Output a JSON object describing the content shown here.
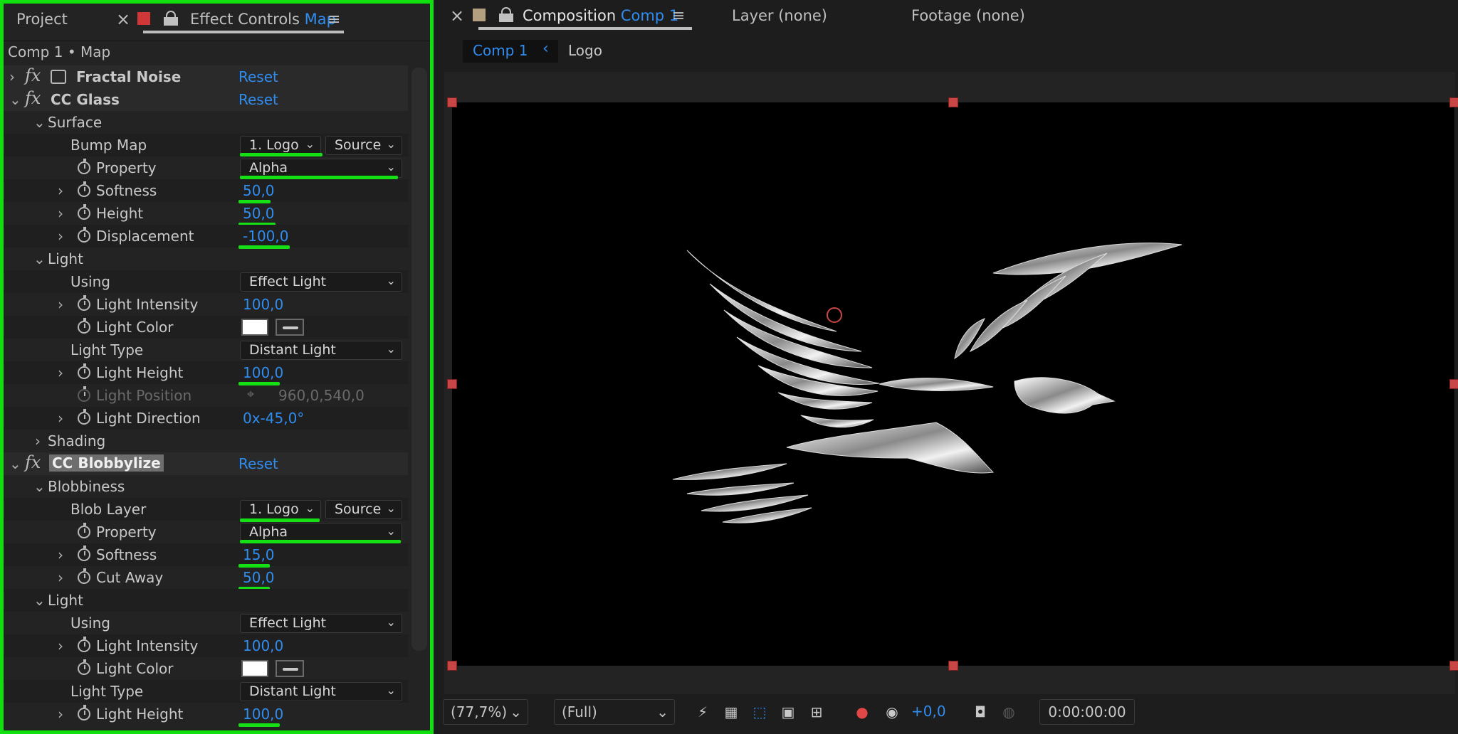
{
  "left_panel": {
    "tabs": {
      "project": "Project",
      "close": "×",
      "effect_controls": "Effect Controls",
      "effect_controls_target": "Map",
      "menu": "≡"
    },
    "breadcrumb": "Comp 1 • Map",
    "effects": [
      {
        "name": "Fractal Noise",
        "reset": "Reset"
      },
      {
        "name": "CC Glass",
        "reset": "Reset"
      },
      {
        "name": "CC Blobbylize",
        "reset": "Reset"
      }
    ],
    "glass": {
      "surface": "Surface",
      "bump_map": {
        "label": "Bump Map",
        "layer": "1. Logo",
        "source": "Source"
      },
      "property": {
        "label": "Property",
        "value": "Alpha"
      },
      "softness": {
        "label": "Softness",
        "value": "50,0"
      },
      "height": {
        "label": "Height",
        "value": "50,0"
      },
      "displacement": {
        "label": "Displacement",
        "value": "-100,0"
      },
      "light": "Light",
      "using": {
        "label": "Using",
        "value": "Effect Light"
      },
      "light_intensity": {
        "label": "Light Intensity",
        "value": "100,0"
      },
      "light_color": {
        "label": "Light Color",
        "color": "#ffffff"
      },
      "light_type": {
        "label": "Light Type",
        "value": "Distant Light"
      },
      "light_height": {
        "label": "Light Height",
        "value": "100,0"
      },
      "light_position": {
        "label": "Light Position",
        "value": "960,0,540,0"
      },
      "light_direction": {
        "label": "Light Direction",
        "value": "0x-45,0°"
      },
      "shading": "Shading"
    },
    "blob": {
      "blobbiness": "Blobbiness",
      "blob_layer": {
        "label": "Blob Layer",
        "layer": "1. Logo",
        "source": "Source"
      },
      "property": {
        "label": "Property",
        "value": "Alpha"
      },
      "softness": {
        "label": "Softness",
        "value": "15,0"
      },
      "cut_away": {
        "label": "Cut Away",
        "value": "50,0"
      },
      "light": "Light",
      "using": {
        "label": "Using",
        "value": "Effect Light"
      },
      "light_intensity": {
        "label": "Light Intensity",
        "value": "100,0"
      },
      "light_color": {
        "label": "Light Color",
        "color": "#ffffff"
      },
      "light_type": {
        "label": "Light Type",
        "value": "Distant Light"
      },
      "light_height": {
        "label": "Light Height",
        "value": "100,0"
      }
    }
  },
  "right_panel": {
    "tabs": {
      "close": "×",
      "composition": "Composition",
      "composition_target": "Comp 1",
      "menu": "≡",
      "layer": "Layer (none)",
      "footage": "Footage (none)"
    },
    "breadcrumb": {
      "comp": "Comp 1",
      "arrow": "‹",
      "logo": "Logo"
    },
    "bottom": {
      "zoom": "(77,7%)",
      "resolution": "(Full)",
      "exposure": "+0,0",
      "timecode": "0:00:00:00"
    }
  },
  "colors": {
    "accent": "#2f8df0",
    "highlight": "#14e014",
    "handles": "#c84646"
  }
}
